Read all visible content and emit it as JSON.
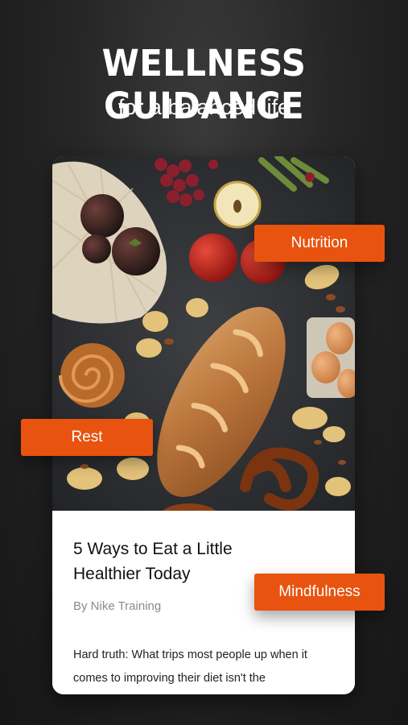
{
  "header": {
    "headline": "WELLNESS GUIDANCE",
    "subheadline": "for a balanced life"
  },
  "card": {
    "image_alt": "Bread, apples, eggs, pretzel and snacks on dark countertop",
    "title": "5 Ways to Eat a Little Healthier Today",
    "byline": "By Nike Training",
    "excerpt": "Hard truth: What trips most people up when it comes to improving their diet isn't the"
  },
  "tags": {
    "nutrition": "Nutrition",
    "rest": "Rest",
    "mindfulness": "Mindfulness"
  },
  "colors": {
    "accent": "#e8530f",
    "background": "#262626",
    "card": "#ffffff"
  }
}
